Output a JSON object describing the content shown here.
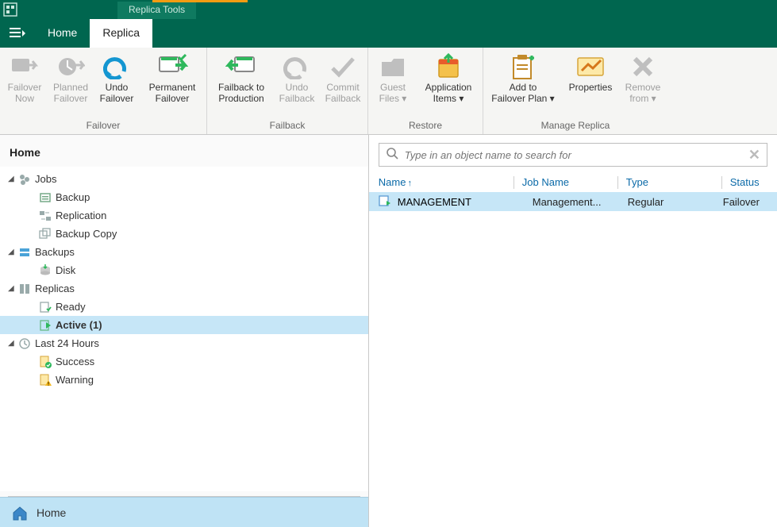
{
  "contextual_tab": "Replica Tools",
  "tabs": {
    "home": "Home",
    "replica": "Replica"
  },
  "ribbon": {
    "groups": [
      {
        "label": "Failover",
        "items": [
          {
            "line1": "Failover",
            "line2": "Now",
            "name": "failover-now-button",
            "disabled": true
          },
          {
            "line1": "Planned",
            "line2": "Failover",
            "name": "planned-failover-button",
            "disabled": true
          },
          {
            "line1": "Undo",
            "line2": "Failover",
            "name": "undo-failover-button",
            "disabled": false
          },
          {
            "line1": "Permanent",
            "line2": "Failover",
            "name": "permanent-failover-button",
            "disabled": false
          }
        ]
      },
      {
        "label": "Failback",
        "items": [
          {
            "line1": "Failback to",
            "line2": "Production",
            "name": "failback-to-production-button",
            "disabled": false
          },
          {
            "line1": "Undo",
            "line2": "Failback",
            "name": "undo-failback-button",
            "disabled": true
          },
          {
            "line1": "Commit",
            "line2": "Failback",
            "name": "commit-failback-button",
            "disabled": true
          }
        ]
      },
      {
        "label": "Restore",
        "items": [
          {
            "line1": "Guest",
            "line2": "Files ▾",
            "name": "guest-files-button",
            "disabled": true
          },
          {
            "line1": "Application",
            "line2": "Items ▾",
            "name": "application-items-button",
            "disabled": false
          }
        ]
      },
      {
        "label": "Manage Replica",
        "items": [
          {
            "line1": "Add to",
            "line2": "Failover Plan ▾",
            "name": "add-to-failover-plan-button",
            "disabled": false
          },
          {
            "line1": "Properties",
            "line2": "",
            "name": "properties-button",
            "disabled": false
          },
          {
            "line1": "Remove",
            "line2": "from ▾",
            "name": "remove-from-button",
            "disabled": true
          }
        ]
      }
    ]
  },
  "left": {
    "header": "Home",
    "tree": {
      "jobs": {
        "label": "Jobs",
        "children": [
          "Backup",
          "Replication",
          "Backup Copy"
        ]
      },
      "backups": {
        "label": "Backups",
        "children": [
          "Disk"
        ]
      },
      "replicas": {
        "label": "Replicas",
        "children": [
          "Ready",
          "Active (1)"
        ]
      },
      "last24": {
        "label": "Last 24 Hours",
        "children": [
          "Success",
          "Warning"
        ]
      }
    },
    "footer": "Home"
  },
  "search": {
    "placeholder": "Type in an object name to search for"
  },
  "grid": {
    "columns": {
      "name": "Name",
      "job": "Job Name",
      "type": "Type",
      "status": "Status"
    },
    "rows": [
      {
        "name": "MANAGEMENT",
        "job": "Management...",
        "type": "Regular",
        "status": "Failover"
      }
    ]
  }
}
